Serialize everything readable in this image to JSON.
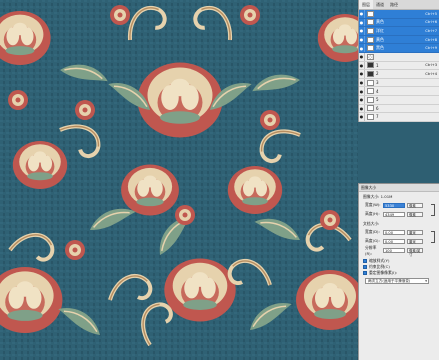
{
  "layers": {
    "tabs": [
      "图层",
      "通道",
      "路径"
    ],
    "items": [
      {
        "name": "",
        "shortcut": "Ctrl+5",
        "selected": true,
        "thumb": "white"
      },
      {
        "name": "黄色",
        "shortcut": "Ctrl+6",
        "selected": true,
        "thumb": "white"
      },
      {
        "name": "洋红",
        "shortcut": "Ctrl+7",
        "selected": true,
        "thumb": "white"
      },
      {
        "name": "黄色",
        "shortcut": "Ctrl+8",
        "selected": true,
        "thumb": "white"
      },
      {
        "name": "黑色",
        "shortcut": "Ctrl+9",
        "selected": true,
        "thumb": "white"
      },
      {
        "name": "",
        "shortcut": "",
        "selected": false,
        "thumb": "checker"
      },
      {
        "name": "1",
        "shortcut": "Ctrl+3",
        "selected": false,
        "thumb": "dark"
      },
      {
        "name": "2",
        "shortcut": "Ctrl+4",
        "selected": false,
        "thumb": "dark"
      },
      {
        "name": "3",
        "shortcut": "",
        "selected": false,
        "thumb": "white"
      },
      {
        "name": "4",
        "shortcut": "",
        "selected": false,
        "thumb": "white"
      },
      {
        "name": "5",
        "shortcut": "",
        "selected": false,
        "thumb": "white"
      },
      {
        "name": "6",
        "shortcut": "",
        "selected": false,
        "thumb": "white"
      },
      {
        "name": "7",
        "shortcut": "",
        "selected": false,
        "thumb": "white"
      }
    ]
  },
  "dialog": {
    "title": "图像大小",
    "size_line": "图像大小: 1.01M",
    "pixel_width_label": "宽度(W):",
    "pixel_width_value": "5330",
    "pixel_width_unit": "像素",
    "pixel_height_label": "高度(H):",
    "pixel_height_value": "4349",
    "pixel_height_unit": "像素",
    "doc_size_label": "文档大小:",
    "doc_width_label": "宽度(D):",
    "doc_width_value": "0.00",
    "doc_width_unit": "厘米",
    "doc_height_label": "高度(G):",
    "doc_height_value": "0.00",
    "doc_height_unit": "厘米",
    "resolution_label": "分辨率(R):",
    "resolution_value": "100",
    "resolution_unit": "像素/英寸",
    "opt_scale_styles": "缩放样式(Y)",
    "opt_constrain": "约束比例(C)",
    "opt_resample": "重定图像像素(I):",
    "resample_method": "两次立方(适用于平滑渐变)"
  },
  "colors": {
    "ground": "#2e5f72",
    "rose": "#c0574f",
    "cream": "#e6d2ad",
    "sage": "#7fa088",
    "selection": "#2f7fd6"
  }
}
